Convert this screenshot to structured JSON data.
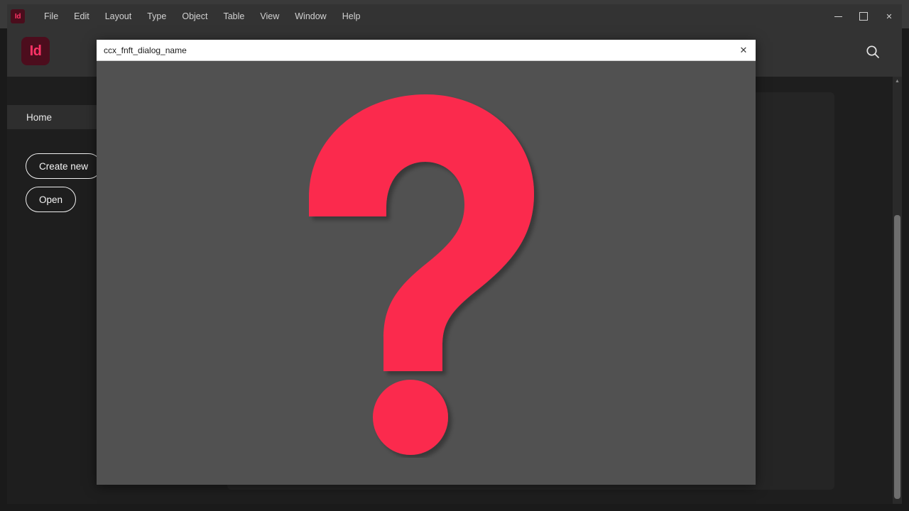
{
  "window": {
    "app_badge": "Id",
    "controls": {
      "minimize": "minimize-icon",
      "maximize": "maximize-icon",
      "close": "✕"
    }
  },
  "menubar": {
    "items": [
      {
        "label": "File"
      },
      {
        "label": "Edit"
      },
      {
        "label": "Layout"
      },
      {
        "label": "Type"
      },
      {
        "label": "Object"
      },
      {
        "label": "Table"
      },
      {
        "label": "View"
      },
      {
        "label": "Window"
      },
      {
        "label": "Help"
      }
    ]
  },
  "header": {
    "logo": "Id",
    "search_icon": "search-icon"
  },
  "sidebar": {
    "nav": [
      {
        "label": "Home",
        "selected": true
      }
    ],
    "buttons": [
      {
        "label": "Create new"
      },
      {
        "label": "Open"
      }
    ]
  },
  "scrollbar": {
    "up_arrow": "▲",
    "down_arrow": "▼"
  },
  "dialog": {
    "title": "ccx_fnft_dialog_name",
    "close_label": "✕",
    "graphic": "question-mark-placeholder"
  },
  "colors": {
    "accent_pink": "#fb2c4e",
    "dialog_background": "#515151",
    "dialog_titlebar": "#ffffff",
    "app_background": "#1e1e1e",
    "chrome": "#333333",
    "badge_maroon": "#4c0d1d"
  }
}
